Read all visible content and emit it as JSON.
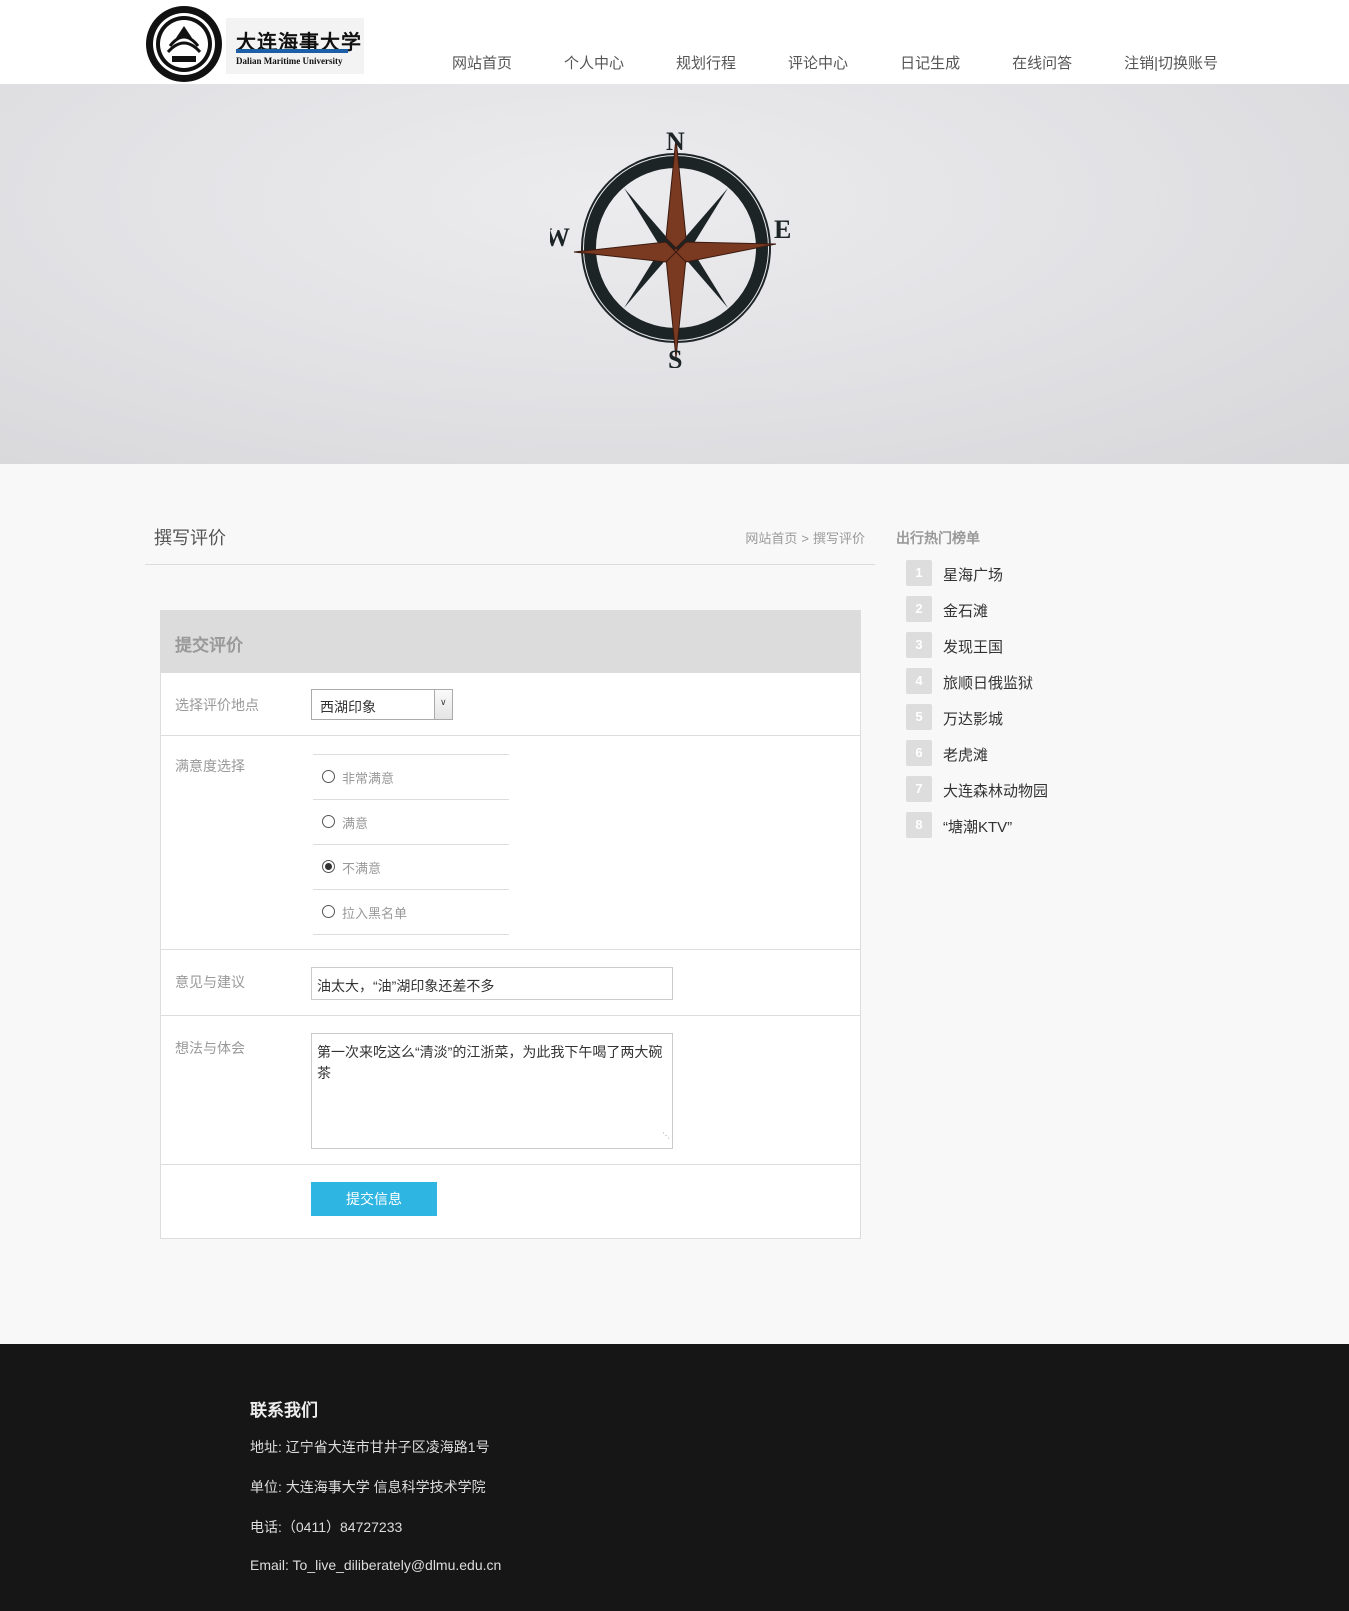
{
  "header": {
    "logo": {
      "cn": "大连海事大学",
      "en": "Dalian Maritime University"
    },
    "nav": [
      "网站首页",
      "个人中心",
      "规划行程",
      "评论中心",
      "日记生成",
      "在线问答",
      "注销|切换账号"
    ]
  },
  "banner": {
    "compass": {
      "n": "N",
      "s": "S",
      "e": "E",
      "w": "W"
    }
  },
  "page": {
    "title": "撰写评价",
    "breadcrumb": {
      "home": "网站首页",
      "sep": ">",
      "current": "撰写评价"
    }
  },
  "form": {
    "title": "提交评价",
    "location_label": "选择评价地点",
    "location_value": "西湖印象",
    "satisfaction_label": "满意度选择",
    "options": [
      {
        "label": "非常满意",
        "checked": false
      },
      {
        "label": "满意",
        "checked": false
      },
      {
        "label": "不满意",
        "checked": true
      },
      {
        "label": "拉入黑名单",
        "checked": false
      }
    ],
    "suggestion_label": "意见与建议",
    "suggestion_value": "油太大，“油”湖印象还差不多",
    "thoughts_label": "想法与体会",
    "thoughts_value": "第一次来吃这么“清淡”的江浙菜，为此我下午喝了两大碗茶",
    "submit_label": "提交信息"
  },
  "sidebar": {
    "title": "出行热门榜单",
    "items": [
      {
        "rank": "1",
        "name": "星海广场"
      },
      {
        "rank": "2",
        "name": "金石滩"
      },
      {
        "rank": "3",
        "name": "发现王国"
      },
      {
        "rank": "4",
        "name": "旅顺日俄监狱"
      },
      {
        "rank": "5",
        "name": "万达影城"
      },
      {
        "rank": "6",
        "name": "老虎滩"
      },
      {
        "rank": "7",
        "name": "大连森林动物园"
      },
      {
        "rank": "8",
        "name": "“塘潮KTV”"
      }
    ]
  },
  "footer": {
    "title": "联系我们",
    "address": "地址: 辽宁省大连市甘井子区凌海路1号",
    "unit": "单位: 大连海事大学 信息科学技术学院",
    "phone": "电话:（0411）84727233",
    "email": "Email: To_live_diliberately@dlmu.edu.cn"
  },
  "colors": {
    "accent": "#2fb5e2",
    "footer_bg": "#161616",
    "logo_bar": "#1d5fa7"
  }
}
